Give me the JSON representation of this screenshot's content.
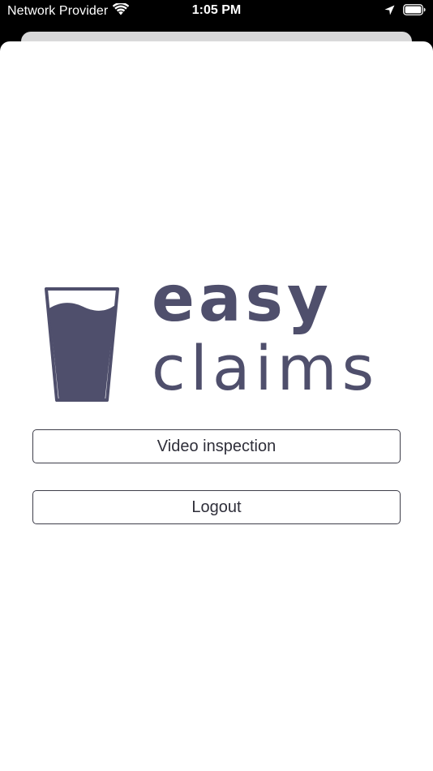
{
  "status_bar": {
    "carrier": "Network Provider",
    "time": "1:05 PM",
    "icons": [
      "wifi-icon",
      "location-arrow-icon",
      "battery-icon"
    ]
  },
  "logo": {
    "line1": "easy",
    "line2": "claims",
    "icon": "glass-icon",
    "color": "#4f4f6c"
  },
  "actions": {
    "video_inspection_label": "Video inspection",
    "logout_label": "Logout"
  },
  "colors": {
    "background": "#000000",
    "sheet": "#ffffff",
    "brand": "#4f4f6c",
    "button_border": "#3e3e4a"
  }
}
